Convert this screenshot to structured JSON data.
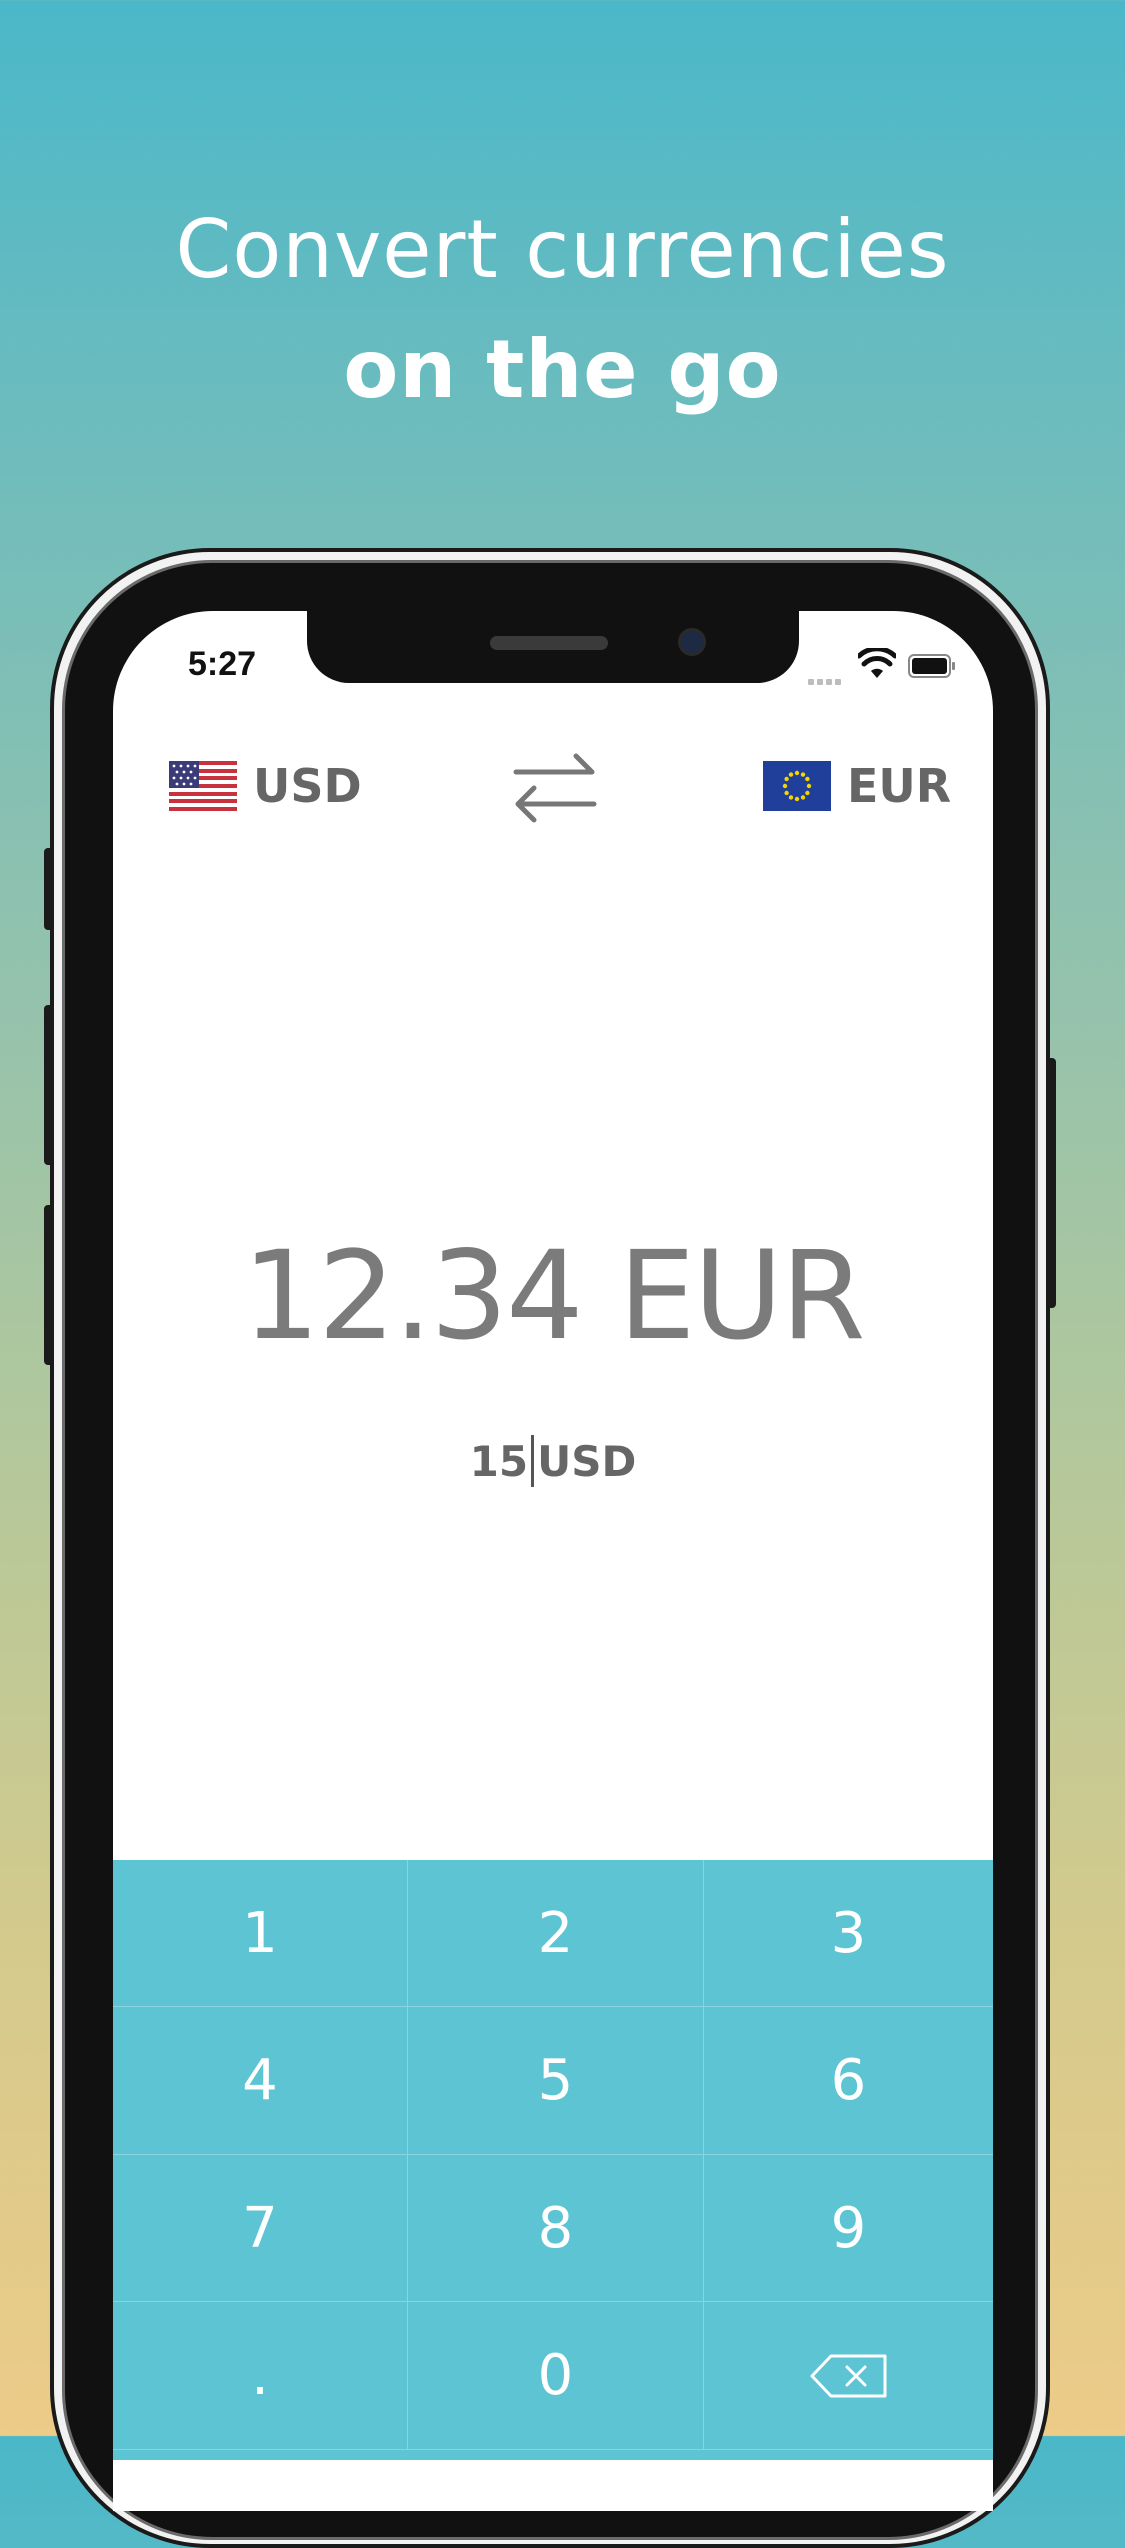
{
  "headline": {
    "line1": "Convert currencies",
    "line2": "on the go"
  },
  "status_bar": {
    "time": "5:27"
  },
  "currencies": {
    "from": {
      "code": "USD",
      "flag_icon": "us-flag-icon"
    },
    "to": {
      "code": "EUR",
      "flag_icon": "eu-flag-icon"
    },
    "swap_icon": "swap-arrows-icon"
  },
  "result": {
    "text": "12.34 EUR"
  },
  "input": {
    "amount": "15",
    "currency": "USD"
  },
  "keypad": {
    "keys": [
      "1",
      "2",
      "3",
      "4",
      "5",
      "6",
      "7",
      "8",
      "9",
      ".",
      "0"
    ],
    "backspace_icon": "backspace-icon"
  },
  "colors": {
    "accent": "#5cc4d3",
    "text_gray": "#7b7b7b"
  }
}
